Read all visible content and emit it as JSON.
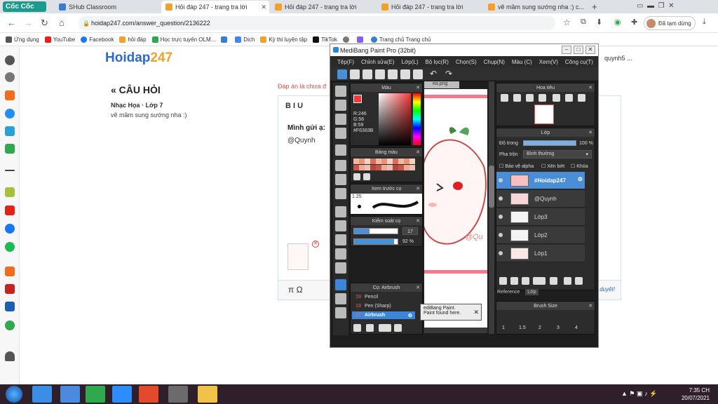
{
  "browser": {
    "brand": "Cốc Cốc",
    "tabs": [
      {
        "label": "SHub Classroom",
        "color": "#3a7bd5"
      },
      {
        "label": "Hỏi đáp 247 - trang tra lời",
        "color": "#f3a12a"
      },
      {
        "label": "Hỏi đáp 247 - trang tra lời",
        "color": "#f3a12a"
      },
      {
        "label": "Hỏi đáp 247 - trang tra lời",
        "color": "#f3a12a"
      },
      {
        "label": "vẽ mầm sung sướng nha :) c...",
        "color": "#f3a12a"
      }
    ],
    "url": "hoidap247.com/answer_question/2136222",
    "profile": "Đã tạm dừng",
    "bookmarks": [
      {
        "label": "Ứng dụng",
        "color": "#555"
      },
      {
        "label": "YouTube",
        "color": "#e62117"
      },
      {
        "label": "Facebook",
        "color": "#1877f2"
      },
      {
        "label": "hỏi đáp",
        "color": "#f3a12a"
      },
      {
        "label": "Học trực tuyến OLM...",
        "color": "#2fa84f"
      },
      {
        "label": "",
        "color": "#3a7bd5"
      },
      {
        "label": "Dịch",
        "color": "#4285f4"
      },
      {
        "label": "Kỳ thi luyện tập",
        "color": "#f3a12a"
      },
      {
        "label": "TikTok",
        "color": "#111"
      },
      {
        "label": "",
        "color": "#777"
      },
      {
        "label": "",
        "color": "#8a5cf6"
      },
      {
        "label": "Trang chủ Trang chủ",
        "color": "#3a7bd5"
      }
    ]
  },
  "page": {
    "logo_main": "Hoidap",
    "logo_num": "247",
    "question_title": "« CÂU HỎI",
    "question_meta": "Nhạc Họa · Lớp 7",
    "question_text": "vẽ mầm sung sướng nha :)",
    "answer_note": "Đáp án là chưa đ",
    "editor_toolbar": "B   I   U",
    "editor_line1": "Mình gửi ạ:",
    "editor_line2": "@Quynh",
    "math_symbols": "π   Ω",
    "duyet": "duyệt!",
    "user_corner": "quynh5 ..."
  },
  "medibang": {
    "title": "MediBang Paint Pro (32bit)",
    "menu": [
      "Tệp(F)",
      "Chỉnh sửa(E)",
      "Lớp(L)",
      "Bộ lọc(R)",
      "Chọn(S)",
      "Chụp(N)",
      "Màu (C)",
      "Xem(V)",
      "Công cụ(T)"
    ],
    "color_panel": "Màu",
    "color_values": [
      "R:246",
      "G:56",
      "B:59",
      "#F6383B"
    ],
    "palette_panel": "Bảng màu",
    "brush_preview_panel": "Xem trước cọ",
    "brush_preview_size": "1.25",
    "brush_control_panel": "Kiểm soát cọ",
    "brush_size": "17",
    "brush_size_pct": 0.35,
    "brush_opacity": "92 %",
    "brush_opacity_pct": 0.92,
    "brush_list_panel": "Cọ: Airbrush",
    "brushes": [
      {
        "num": "19",
        "name": "Pencil"
      },
      {
        "num": "19",
        "name": "Pen (Sharp)"
      },
      {
        "num": "17",
        "name": "Airbrush"
      }
    ],
    "canvas_tab": "ea.png",
    "canvas_watermark": "@Qu",
    "toast_line1": "ediBang Paint.",
    "toast_line2": "Paint found here.",
    "navigator_panel": "Hoa tiêu",
    "layer_panel": "Lớp",
    "opacity_label": "Độ trong",
    "opacity_value": "100 %",
    "blend_label": "Pha trộn",
    "blend_value": "Bình thường",
    "opt_alpha": "Bảo vệ alpha",
    "opt_clip": "Xén bớt",
    "opt_lock": "Khóa",
    "layers": [
      "#Hoidap247",
      "@Quynh",
      "Lớp3",
      "Lớp2",
      "Lớp1"
    ],
    "tabs_bottom": [
      "Reference",
      "Lớp"
    ],
    "brush_size_panel": "Brush Size",
    "brush_sizes": [
      "1",
      "1.5",
      "2",
      "3",
      "4"
    ]
  },
  "taskbar": {
    "time": "7:35 CH",
    "date": "20/07/2021",
    "apps": [
      "#3a8ee6",
      "#4a8be0",
      "#2fa84f",
      "#2d8cff",
      "#e24a2b",
      "#6b6b6b",
      "#f0c24a"
    ]
  }
}
